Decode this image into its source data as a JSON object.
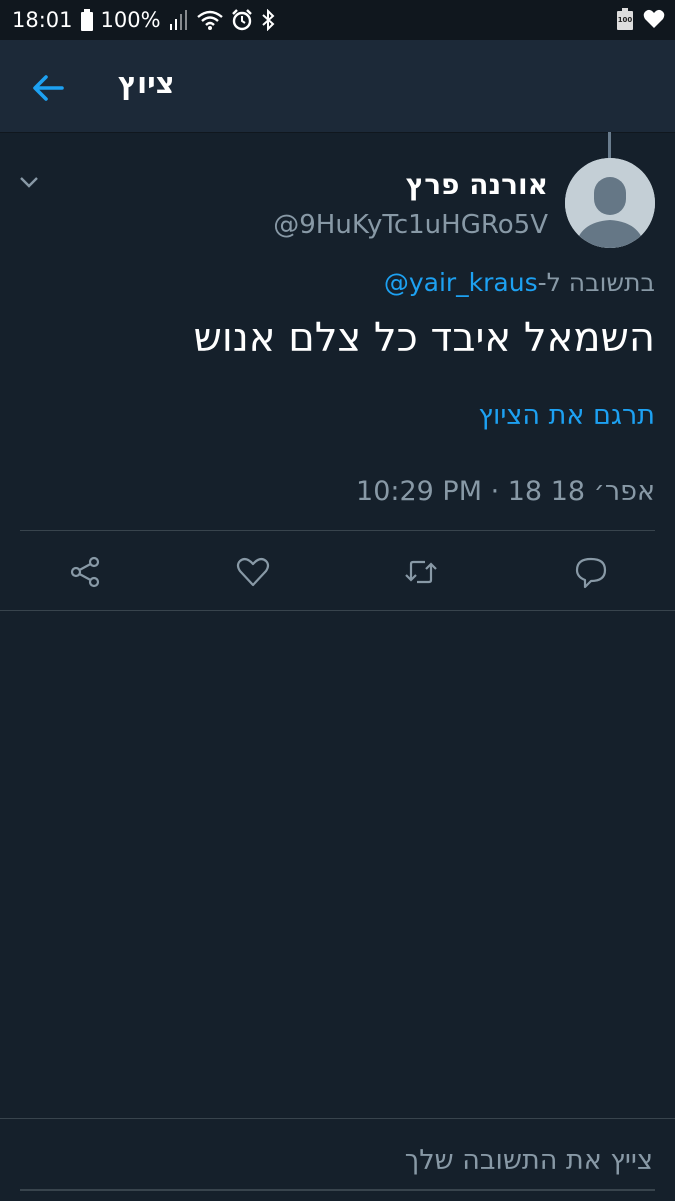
{
  "status_bar": {
    "time": "18:01",
    "battery_percent": "100%",
    "battery_badge": "100"
  },
  "header": {
    "title": "ציוץ"
  },
  "tweet": {
    "author_name": "אורנה פרץ",
    "handle": "@9HuKyTc1uHGRo5V",
    "reply_prefix": "בתשובה ל-",
    "reply_to": "@yair_kraus",
    "text": "השמאל איבד כל צלם אנוש",
    "translate_label": "תרגם את הציוץ",
    "timestamp": "10:29 PM · 18 אפר׳ 18"
  },
  "actions": [
    "comment-icon",
    "retweet-icon",
    "like-icon",
    "share-icon"
  ],
  "compose": {
    "placeholder": "צייץ את התשובה שלך"
  },
  "colors": {
    "background": "#15202b",
    "header": "#1c2938",
    "accent": "#1da1f2",
    "muted": "#8899a6"
  }
}
